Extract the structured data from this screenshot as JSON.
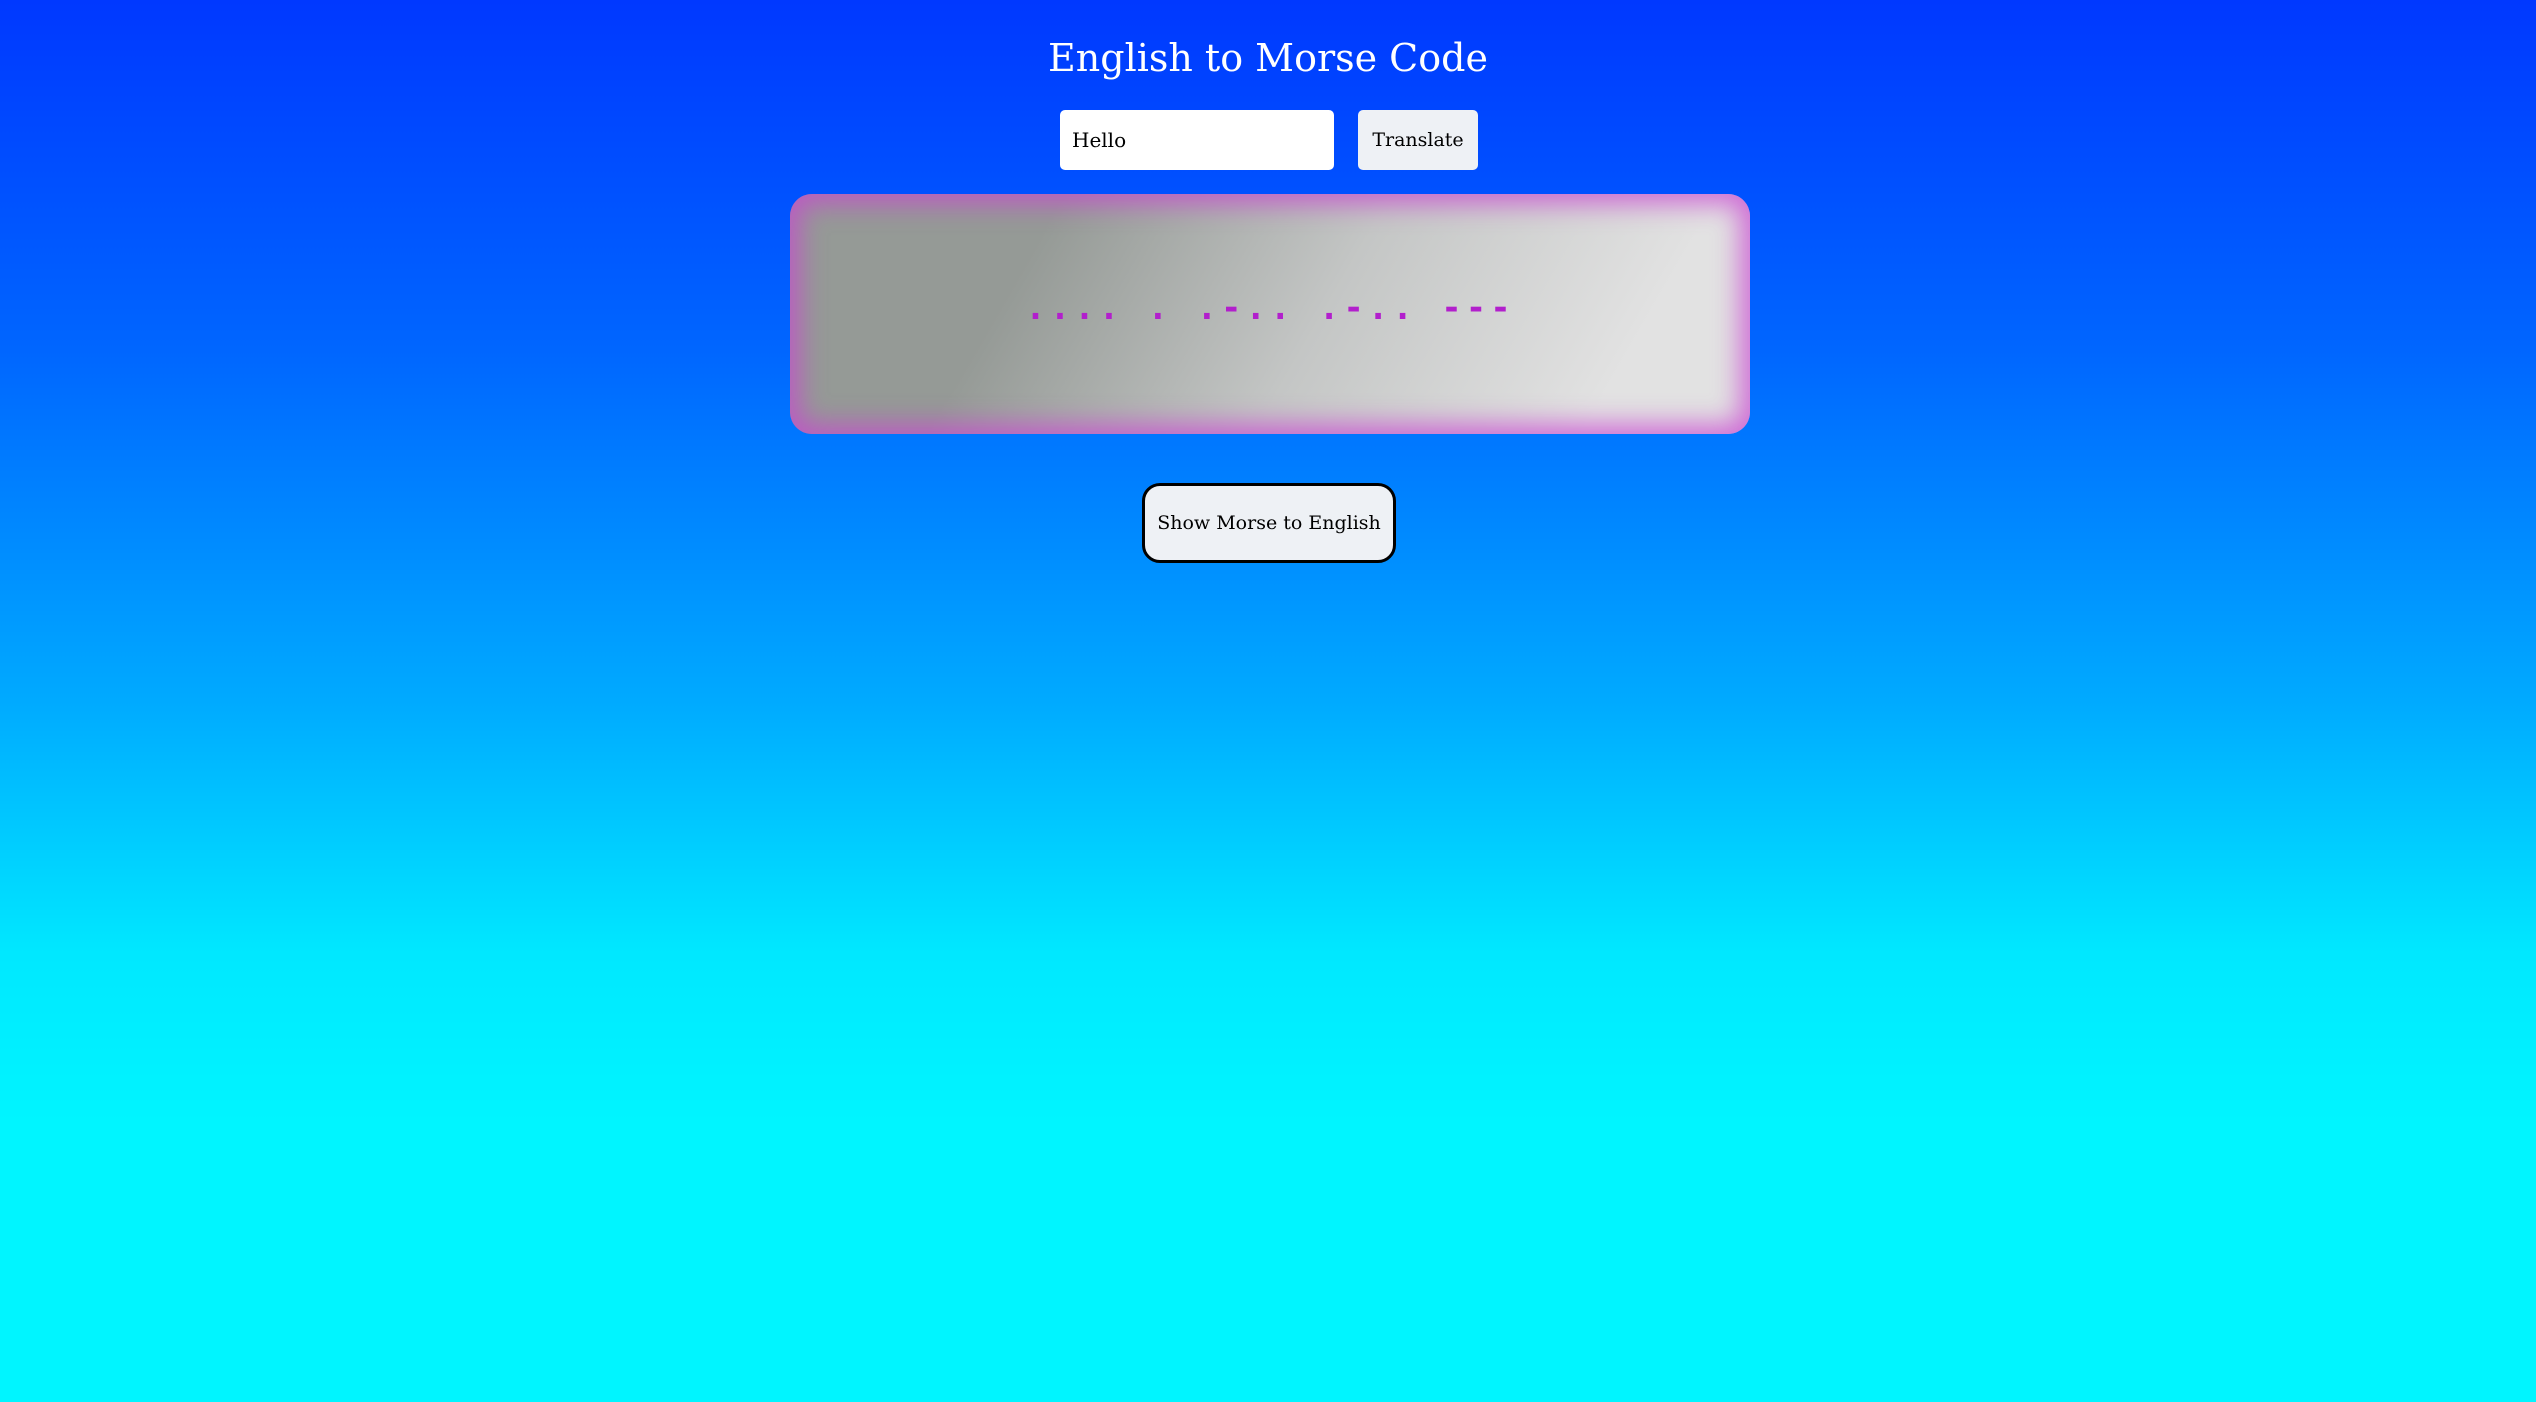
{
  "page": {
    "title": "English to Morse Code"
  },
  "translator": {
    "input_value": "Hello",
    "translate_label": "Translate",
    "output": ".... . .-.. .-.. ---"
  },
  "toggle": {
    "label": "Show Morse to English"
  },
  "colors": {
    "background_top": "#0038ff",
    "background_bottom": "#00f5ff",
    "morse_text": "#b21fcc",
    "output_glow": "#c846d2"
  }
}
